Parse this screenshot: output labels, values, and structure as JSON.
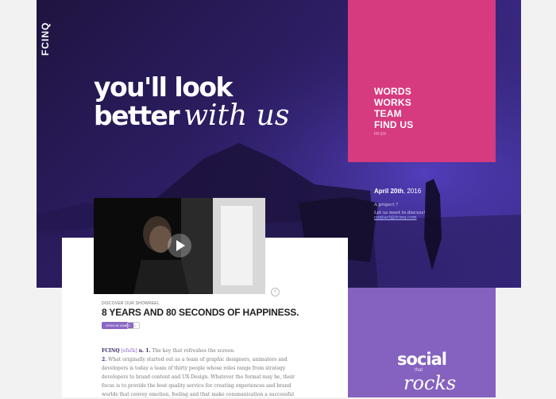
{
  "brand": {
    "logo": "FCINQ"
  },
  "hero": {
    "line1": "you'll look",
    "line2_bold": "better",
    "line2_script": "with us"
  },
  "menu": {
    "items": [
      "WORDS",
      "WORKS",
      "TEAM",
      "FIND US"
    ],
    "lang": "FR  EN"
  },
  "meta": {
    "date_bold": "April 20th",
    "date_rest": ", 2016",
    "question": "A project ?",
    "discuss": "Let us meet to discuss!",
    "email": "contact@fcinq.com"
  },
  "showreel": {
    "eyebrow": "DISCOVER OUR SHOWREEL",
    "title": "8 YEARS AND 80 SECONDS OF HAPPINESS.",
    "tag": "OPEN IN VIMEO",
    "tag2": "HD"
  },
  "intro": {
    "brand": "FCINQ",
    "phonetic": "[efsɛ̃k]",
    "n1": "n. 1.",
    "def1": " The key that refreshes the screen.",
    "n2": "2.",
    "def2": " What originally started out as a team of graphic designers, animators and developers is today a team of thirty people whose roles range from strategy developers to brand content and UX Design. Whatever the format may be, their focus is to provide the best quality service for creating experiences and brand worlds that convey emotion, feeling and that make communication a successful"
  },
  "social": {
    "word1": "social",
    "word2": "that",
    "word3": "rocks"
  },
  "colors": {
    "menu": "#d63a7f",
    "social": "#8562bf",
    "hero": "#2d1d63"
  }
}
